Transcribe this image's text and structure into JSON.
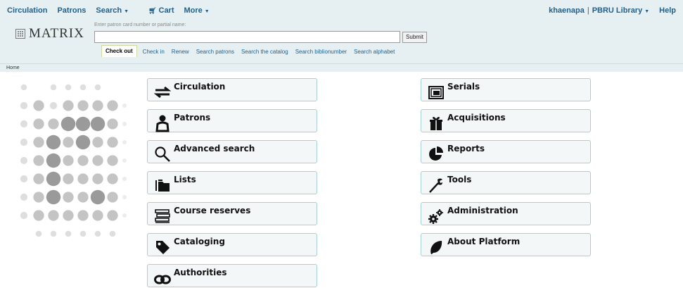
{
  "topnav": {
    "left": [
      {
        "label": "Circulation",
        "caret": false
      },
      {
        "label": "Patrons",
        "caret": false
      },
      {
        "label": "Search",
        "caret": true
      },
      {
        "label": "Cart",
        "caret": false
      },
      {
        "label": "More",
        "caret": true
      }
    ],
    "user": "khaenapa",
    "separator": "|",
    "library": "PBRU Library",
    "help": "Help"
  },
  "logo": {
    "text": "MATRIX"
  },
  "search": {
    "hint": "Enter patron card number or partial name:",
    "value": "",
    "submit": "Submit"
  },
  "tabs": [
    {
      "label": "Check out",
      "active": true
    },
    {
      "label": "Check in",
      "active": false
    },
    {
      "label": "Renew",
      "active": false
    },
    {
      "label": "Search patrons",
      "active": false
    },
    {
      "label": "Search the catalog",
      "active": false
    },
    {
      "label": "Search biblionumber",
      "active": false
    },
    {
      "label": "Search alphabet",
      "active": false
    }
  ],
  "breadcrumb": "Home",
  "modules_left": [
    {
      "label": "Circulation",
      "icon": "arrows-icon"
    },
    {
      "label": "Patrons",
      "icon": "patron-icon"
    },
    {
      "label": "Advanced search",
      "icon": "search-icon"
    },
    {
      "label": "Lists",
      "icon": "folder-icon"
    },
    {
      "label": "Course reserves",
      "icon": "books-icon"
    },
    {
      "label": "Cataloging",
      "icon": "tag-icon"
    },
    {
      "label": "Authorities",
      "icon": "link-icon"
    }
  ],
  "modules_right": [
    {
      "label": "Serials",
      "icon": "newspaper-icon"
    },
    {
      "label": "Acquisitions",
      "icon": "gift-icon"
    },
    {
      "label": "Reports",
      "icon": "pie-chart-icon"
    },
    {
      "label": "Tools",
      "icon": "wrench-icon"
    },
    {
      "label": "Administration",
      "icon": "gears-icon"
    },
    {
      "label": "About Platform",
      "icon": "leaf-icon"
    }
  ],
  "colors": {
    "link": "#1f5f8b",
    "header_bg": "#e6f0f2",
    "module_border": "#a9cfd3"
  }
}
